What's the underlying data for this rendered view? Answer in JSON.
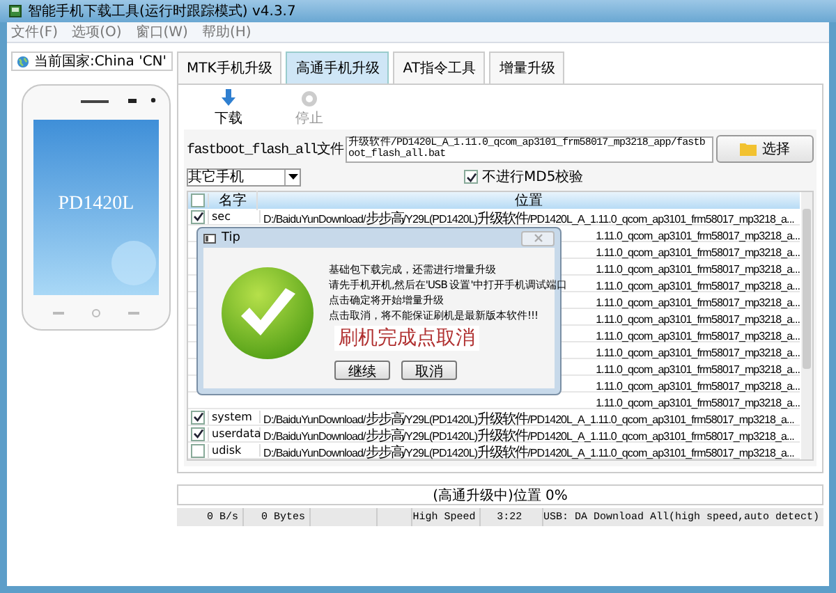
{
  "window": {
    "title": "智能手机下载工具(运行时跟踪模式)  v4.3.7"
  },
  "menu": [
    "文件(F)",
    "选项(O)",
    "窗口(W)",
    "帮助(H)"
  ],
  "sidebar": {
    "country": "当前国家:China 'CN'",
    "phone_model": "PD1420L"
  },
  "tabs": [
    {
      "label": "MTK手机升级",
      "selected": false
    },
    {
      "label": "高通手机升级",
      "selected": true
    },
    {
      "label": "AT指令工具",
      "selected": false
    },
    {
      "label": "增量升级",
      "selected": false
    }
  ],
  "toolbar": [
    {
      "label": "下载",
      "disabled": false,
      "kind": "download"
    },
    {
      "label": "停止",
      "disabled": true,
      "kind": "stop"
    }
  ],
  "file_row": {
    "label": "fastboot_flash_all文件",
    "value": "升级软件/PD1420L_A_1.11.0_qcom_ap3101_frm58017_mp3218_app/fastboot_flash_all.bat",
    "button": "选择"
  },
  "phone_select": {
    "value": "其它手机"
  },
  "skip_md5": {
    "label": "不进行MD5校验",
    "checked": true
  },
  "table": {
    "columns": [
      "名字",
      "位置"
    ],
    "all_checked": false,
    "rows": [
      {
        "name": "sec",
        "location": "D:/BaiduYunDownload/步步高/Y29L(PD1420L)升级软件/PD1420L_A_1.11.0_qcom_ap3101_frm58017_mp3218_a...",
        "checked": true,
        "kind": "full"
      },
      {
        "location": "1.11.0_qcom_ap3101_frm58017_mp3218_a...",
        "kind": "covered"
      },
      {
        "location": "1.11.0_qcom_ap3101_frm58017_mp3218_a...",
        "kind": "covered"
      },
      {
        "location": "1.11.0_qcom_ap3101_frm58017_mp3218_a...",
        "kind": "covered"
      },
      {
        "location": "1.11.0_qcom_ap3101_frm58017_mp3218_a...",
        "kind": "covered"
      },
      {
        "location": "1.11.0_qcom_ap3101_frm58017_mp3218_a...",
        "kind": "covered"
      },
      {
        "location": "1.11.0_qcom_ap3101_frm58017_mp3218_a...",
        "kind": "covered"
      },
      {
        "location": "1.11.0_qcom_ap3101_frm58017_mp3218_a...",
        "kind": "covered"
      },
      {
        "location": "1.11.0_qcom_ap3101_frm58017_mp3218_a...",
        "kind": "covered"
      },
      {
        "location": "1.11.0_qcom_ap3101_frm58017_mp3218_a...",
        "kind": "covered"
      },
      {
        "location": "1.11.0_qcom_ap3101_frm58017_mp3218_a...",
        "kind": "covered"
      },
      {
        "location": "1.11.0_qcom_ap3101_frm58017_mp3218_a...",
        "kind": "covered"
      },
      {
        "name": "system",
        "location": "D:/BaiduYunDownload/步步高/Y29L(PD1420L)升级软件/PD1420L_A_1.11.0_qcom_ap3101_frm58017_mp3218_a...",
        "checked": true,
        "kind": "full"
      },
      {
        "name": "userdata",
        "location": "D:/BaiduYunDownload/步步高/Y29L(PD1420L)升级软件/PD1420L_A_1.11.0_qcom_ap3101_frm58017_mp3218_a...",
        "checked": true,
        "kind": "full"
      },
      {
        "name": "udisk",
        "location": "D:/BaiduYunDownload/步步高/Y29L(PD1420L)升级软件/PD1420L_A_1.11.0_qcom_ap3101_frm58017_mp3218_a...",
        "checked": false,
        "kind": "full"
      }
    ]
  },
  "dialog": {
    "title": "Tip",
    "lines": [
      "基础包下载完成，还需进行增量升级",
      "请先手机开机,然后在'USB 设置'中打开手机调试端口",
      "点击确定将开始增量升级",
      "点击取消，将不能保证刷机是最新版本软件!!!"
    ],
    "annotation": "刷机完成点取消",
    "buttons": [
      "继续",
      "取消"
    ]
  },
  "progress": {
    "label": "(高通升级中)位置 0%",
    "level": 0
  },
  "status_bar": [
    "0 B/s",
    "0 Bytes",
    "High Speed",
    "3:22",
    "USB: DA Download All(high speed,auto detect)"
  ]
}
